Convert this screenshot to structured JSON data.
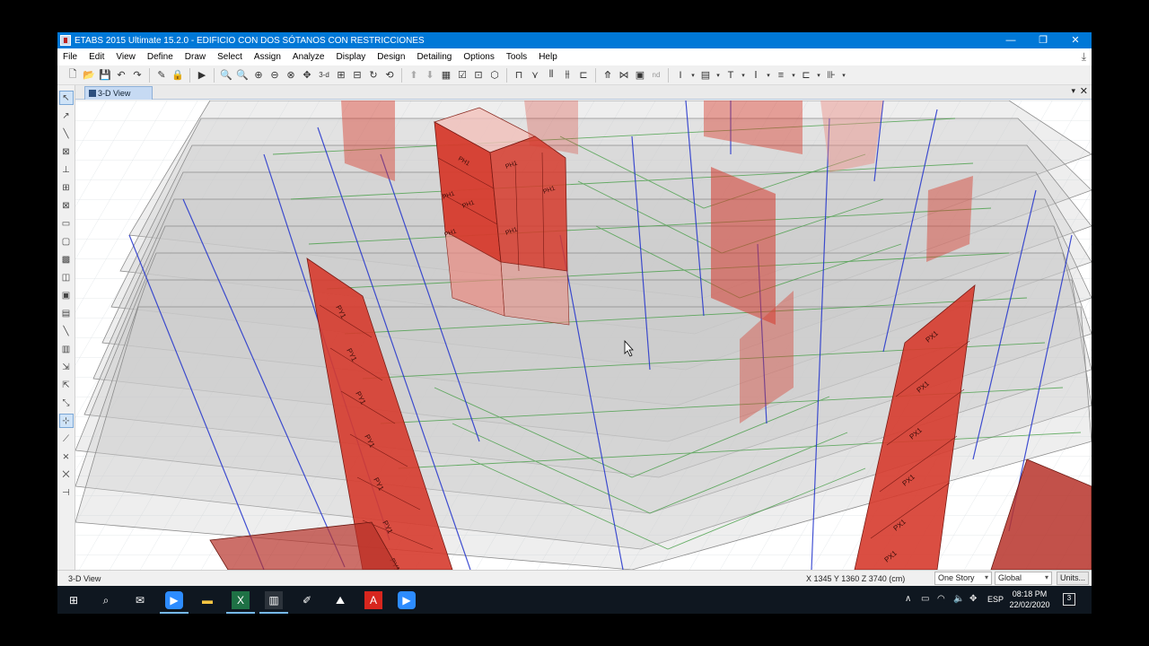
{
  "window": {
    "title": "ETABS 2015 Ultimate 15.2.0 - EDIFICIO CON DOS SÓTANOS CON RESTRICCIONES",
    "minimize": "—",
    "maximize": "❐",
    "close": "✕"
  },
  "menu": {
    "items": [
      "File",
      "Edit",
      "View",
      "Define",
      "Draw",
      "Select",
      "Assign",
      "Analyze",
      "Display",
      "Design",
      "Detailing",
      "Options",
      "Tools",
      "Help"
    ]
  },
  "toolbar": {
    "view_3d_label": "3-d",
    "nd_label": "nd"
  },
  "tab": {
    "label": "3-D View",
    "pin": "▾",
    "close": "✕"
  },
  "viewport": {
    "wall_labels_left": [
      "PY1",
      "PY1",
      "PY1",
      "PY1",
      "PY1",
      "PY1",
      "PY1"
    ],
    "wall_labels_right": [
      "PX1",
      "PX1",
      "PX1",
      "PX1",
      "PX1",
      "PX1"
    ],
    "core_labels": [
      "PH1",
      "PH1",
      "PH1",
      "PH1",
      "PH1",
      "PH1",
      "PH1"
    ],
    "colors": {
      "wall_red": "#d63b2d",
      "wall_red_light": "#e98a80",
      "slab_gray": "#c8c8c8",
      "beam_green": "#2f8f2f",
      "column_blue": "#2233cc"
    }
  },
  "status": {
    "left": "3-D View",
    "coords": "X 1345  Y 1360  Z 3740 (cm)",
    "story_select": "One Story",
    "coord_select": "Global",
    "units_button": "Units..."
  },
  "taskbar": {
    "lang": "ESP",
    "time": "08:18 PM",
    "date": "22/02/2020",
    "notifications": "3"
  }
}
